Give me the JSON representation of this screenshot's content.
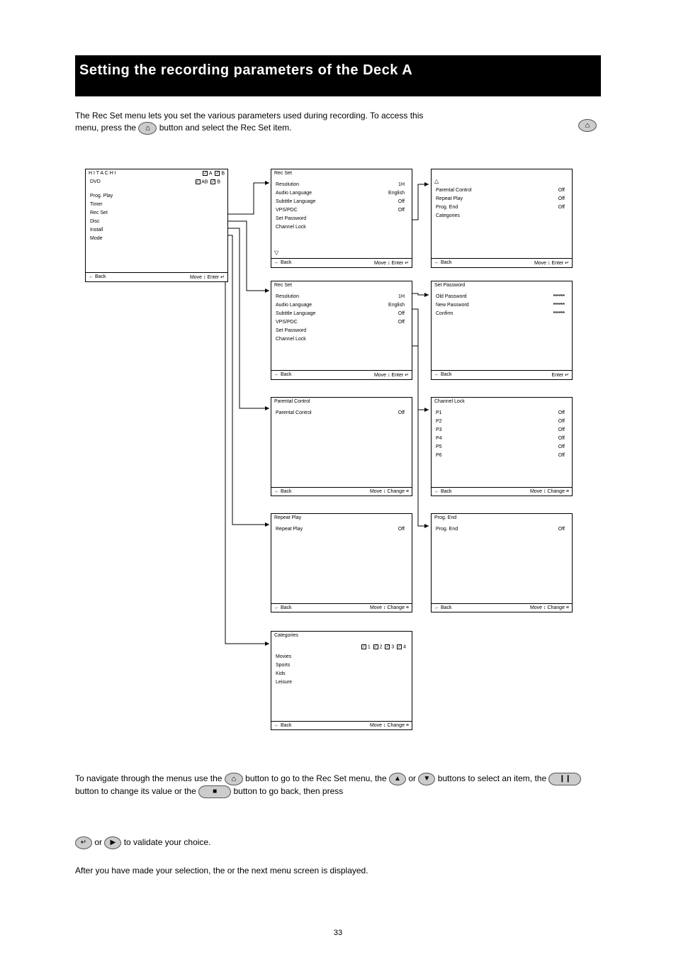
{
  "page_number": "33",
  "banner": {
    "title": "Setting the recording parameters of the Deck A"
  },
  "intro": {
    "line1": "The Rec Set menu lets you set the various parameters used during recording. To access this",
    "line2_before": "menu, press the ",
    "line2_after": " button and select the Rec Set item."
  },
  "main_menu": {
    "header_left": "H I T A C H I",
    "header_right_a": "A",
    "header_right_b": "B",
    "header_row2_left": "DVD",
    "header_row2_a": "AB",
    "header_row2_b": "B",
    "items": [
      "Prog. Play",
      "Timer",
      "Rec Set",
      "Disc",
      "Install",
      "Mode"
    ],
    "footer_left": "← Back",
    "footer_right": "Move ↕     Enter ↵"
  },
  "recset_upper": {
    "title": "Rec Set",
    "rows": [
      {
        "label": "Resolution",
        "value": "1H"
      },
      {
        "label": "Audio Language",
        "value": "English"
      },
      {
        "label": "Subtitle Language",
        "value": "Off"
      },
      {
        "label": "VPS/PDC",
        "value": "Off"
      },
      {
        "label": "Set Password",
        "value": ""
      },
      {
        "label": "Channel Lock",
        "value": ""
      }
    ],
    "footer_left": "← Back",
    "footer_right": "Move ↕     Enter ↵"
  },
  "recset_lower": {
    "rows": [
      {
        "label": "Parental Control",
        "value": "Off"
      },
      {
        "label": "Repeat Play",
        "value": "Off"
      },
      {
        "label": "Prog. End",
        "value": "Off"
      },
      {
        "label": "Categories",
        "value": ""
      }
    ],
    "footer_left": "← Back",
    "footer_right": "Move ↕     Enter ↵"
  },
  "password_screen": {
    "title": "Set Password",
    "rows": [
      {
        "label": "Old Password",
        "value": "******"
      },
      {
        "label": "New Password",
        "value": "******"
      },
      {
        "label": "Confirm",
        "value": "******"
      }
    ],
    "footer_left": "← Back",
    "footer_right": "Enter ↵"
  },
  "channel_lock": {
    "title": "Channel Lock",
    "rows": [
      {
        "label": "P1",
        "value": "Off"
      },
      {
        "label": "P2",
        "value": "Off"
      },
      {
        "label": "P3",
        "value": "Off"
      },
      {
        "label": "P4",
        "value": "Off"
      },
      {
        "label": "P5",
        "value": "Off"
      },
      {
        "label": "P6",
        "value": "Off"
      }
    ],
    "footer_left": "← Back",
    "footer_right": "Move ↕     Change ≡"
  },
  "parental_screen": {
    "title": "Parental Control",
    "rows": [
      {
        "label": "Parental Control",
        "value": "Off"
      }
    ],
    "footer_left": "← Back",
    "footer_right": "Move ↕     Change ≡"
  },
  "repeat_screen": {
    "title": "Repeat Play",
    "rows": [
      {
        "label": "Repeat Play",
        "value": "Off"
      }
    ],
    "footer_left": "← Back",
    "footer_right": "Move ↕     Change ≡"
  },
  "progend_screen": {
    "title": "Prog. End",
    "rows": [
      {
        "label": "Prog. End",
        "value": "Off"
      }
    ],
    "footer_left": "← Back",
    "footer_right": "Move ↕     Change ≡"
  },
  "categories_screen": {
    "title": "Categories",
    "header_cols": [
      "1",
      "2",
      "3",
      "4"
    ],
    "rows": [
      "Movies",
      "Sports",
      "Kids",
      "Leisure"
    ],
    "footer_left": "← Back",
    "footer_right": "Move ↕     Change ≡"
  },
  "nav_text": {
    "p1_line1": "To navigate through the menus use the",
    "p1_line2_a": " button to go to the Rec Set menu, the ",
    "p1_line2_b": " or ",
    "p1_line2_c": " buttons to",
    "p1_line2_d": " select an item, the ",
    "p1_line2_e": " button to change its value or the ",
    "p1_line2_f": " button to go back, then press",
    "p1_line3_a": " or ",
    "p1_line3_b": " to validate your choice.",
    "after_para": "After you have made your selection, the or the next menu screen is displayed."
  },
  "icons": {
    "menu": "⌂",
    "up": "▲",
    "down": "▼",
    "pause": "❙❙",
    "stop": "■",
    "enter": "↵",
    "play": "▶"
  }
}
